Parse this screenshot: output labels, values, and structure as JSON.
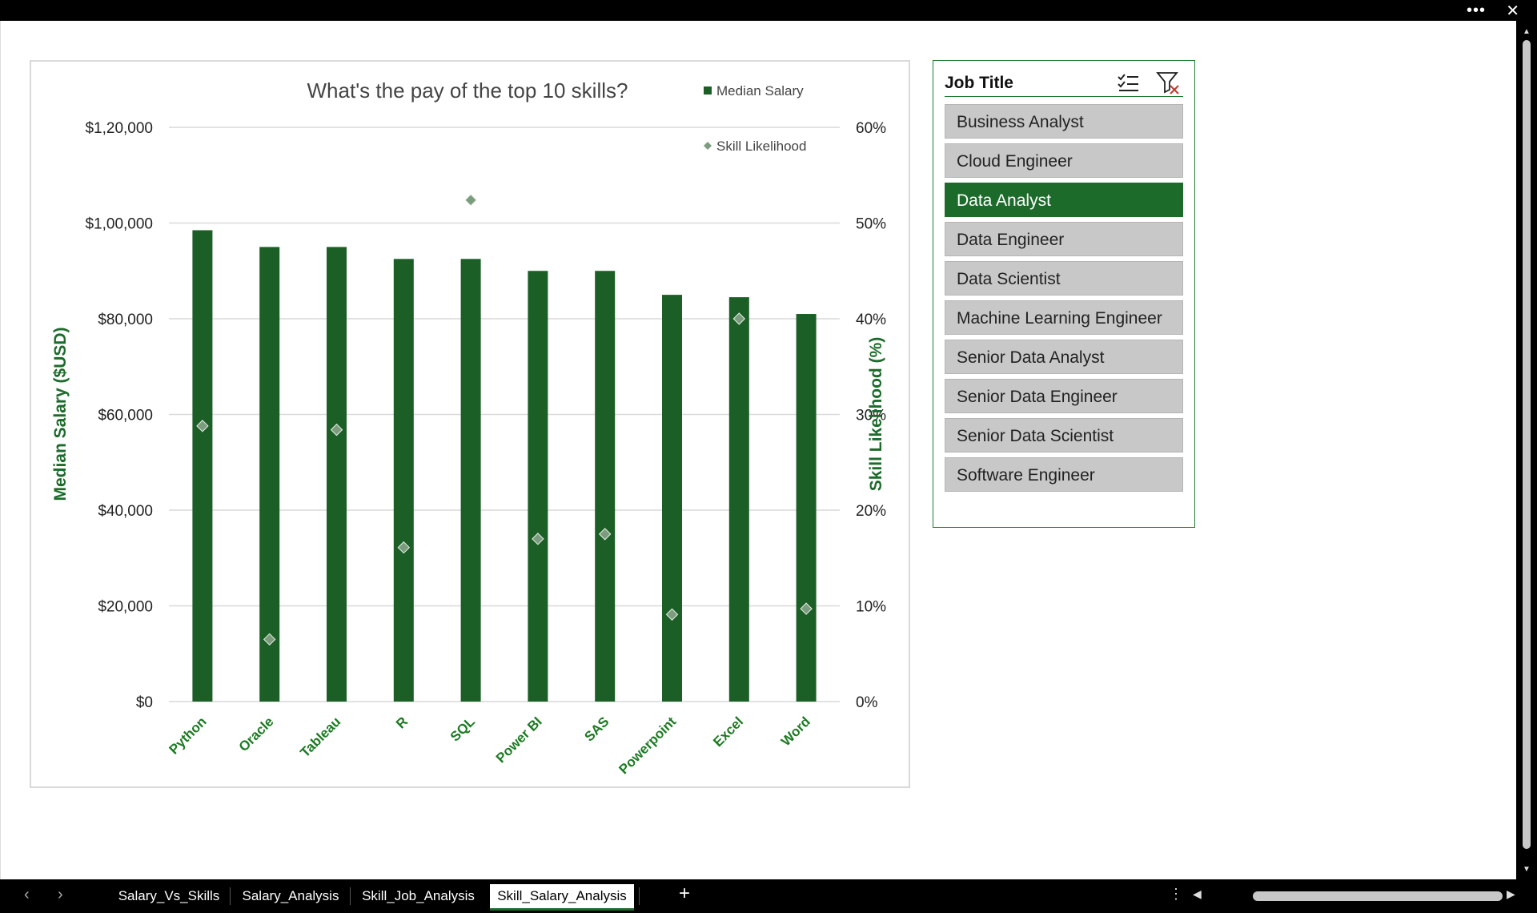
{
  "window": {
    "more_label": "•••",
    "close_label": "✕"
  },
  "chart_data": {
    "type": "bar",
    "title": "What's the pay of the top 10 skills?",
    "categories": [
      "Python",
      "Oracle",
      "Tableau",
      "R",
      "SQL",
      "Power BI",
      "SAS",
      "Powerpoint",
      "Excel",
      "Word"
    ],
    "series": [
      {
        "name": "Median Salary",
        "type": "bar",
        "axis": "left",
        "values": [
          98500,
          95000,
          95000,
          92500,
          92500,
          90000,
          90000,
          85000,
          84500,
          81000
        ]
      },
      {
        "name": "Skill Likelihood",
        "type": "scatter",
        "axis": "right",
        "values": [
          0.288,
          0.065,
          0.284,
          0.161,
          0.524,
          0.17,
          0.175,
          0.091,
          0.4,
          0.097
        ]
      }
    ],
    "ylabel": "Median Salary ($USD)",
    "y2label": "Skill Likelihood (%)",
    "ylim": [
      0,
      120000
    ],
    "y2lim": [
      0,
      0.6
    ],
    "yticks": [
      "$0",
      "$20,000",
      "$40,000",
      "$60,000",
      "$80,000",
      "$1,00,000",
      "$1,20,000"
    ],
    "y2ticks": [
      "0%",
      "10%",
      "20%",
      "30%",
      "40%",
      "50%",
      "60%"
    ],
    "grid": true,
    "legend_position": "top-right",
    "colors": {
      "bar": "#1c5f26",
      "marker": "#7c9c7e",
      "axis_title": "#1c6b2a",
      "grid": "#d9d9d9"
    }
  },
  "slicer": {
    "title": "Job Title",
    "multi_select_icon": "multi-select-icon",
    "clear_filter_icon": "clear-filter-icon",
    "items": [
      {
        "label": "Business Analyst",
        "selected": false
      },
      {
        "label": "Cloud Engineer",
        "selected": false
      },
      {
        "label": "Data Analyst",
        "selected": true
      },
      {
        "label": "Data Engineer",
        "selected": false
      },
      {
        "label": "Data Scientist",
        "selected": false
      },
      {
        "label": "Machine Learning Engineer",
        "selected": false
      },
      {
        "label": "Senior Data Analyst",
        "selected": false
      },
      {
        "label": "Senior Data Engineer",
        "selected": false
      },
      {
        "label": "Senior Data Scientist",
        "selected": false
      },
      {
        "label": "Software Engineer",
        "selected": false
      }
    ]
  },
  "tabs": [
    {
      "label": "Salary_Vs_Skills",
      "active": false
    },
    {
      "label": "Salary_Analysis",
      "active": false
    },
    {
      "label": "Skill_Job_Analysis",
      "active": false
    },
    {
      "label": "Skill_Salary_Analysis",
      "active": true
    }
  ],
  "tabbar": {
    "prev_label": "‹",
    "next_label": "›",
    "add_label": "+",
    "menu_label": "⋮"
  }
}
